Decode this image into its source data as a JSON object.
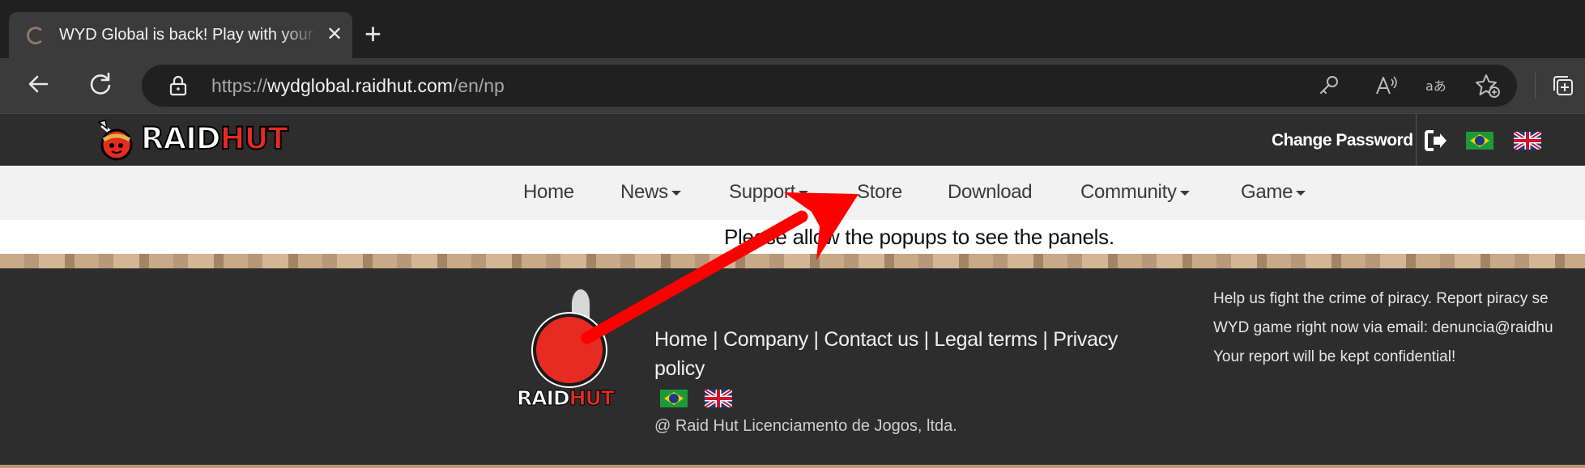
{
  "browser": {
    "tab_title": "WYD Global is back! Play with your friends",
    "tab_close": "✕",
    "new_tab": "+",
    "url_prefix": "https://",
    "url_host": "wydglobal.raidhut.com",
    "url_path": "/en/np"
  },
  "header": {
    "logo_raid": "RAID",
    "logo_hut": "HUT",
    "change_password": "Change Password"
  },
  "nav": {
    "items": [
      {
        "label": "Home"
      },
      {
        "label": "News"
      },
      {
        "label": "Support"
      },
      {
        "label": "Store"
      },
      {
        "label": "Download"
      },
      {
        "label": "Community"
      },
      {
        "label": "Game"
      }
    ]
  },
  "notice": "Please allow the popups to see the panels.",
  "footer": {
    "logo_raid": "RAID",
    "logo_hut": "HUT",
    "links": [
      "Home",
      "Company",
      "Contact us",
      "Legal terms",
      "Privacy policy"
    ],
    "separator": " | ",
    "copyright": "@ Raid Hut Licenciamento de Jogos, ltda.",
    "piracy_lines": [
      "Help us fight the crime of piracy. Report piracy se",
      "WYD game right now via email: denuncia@raidhu",
      "Your report will be kept confidential!"
    ]
  },
  "colors": {
    "accent_red": "#e52b22",
    "annotation_arrow": "#ff0000"
  }
}
